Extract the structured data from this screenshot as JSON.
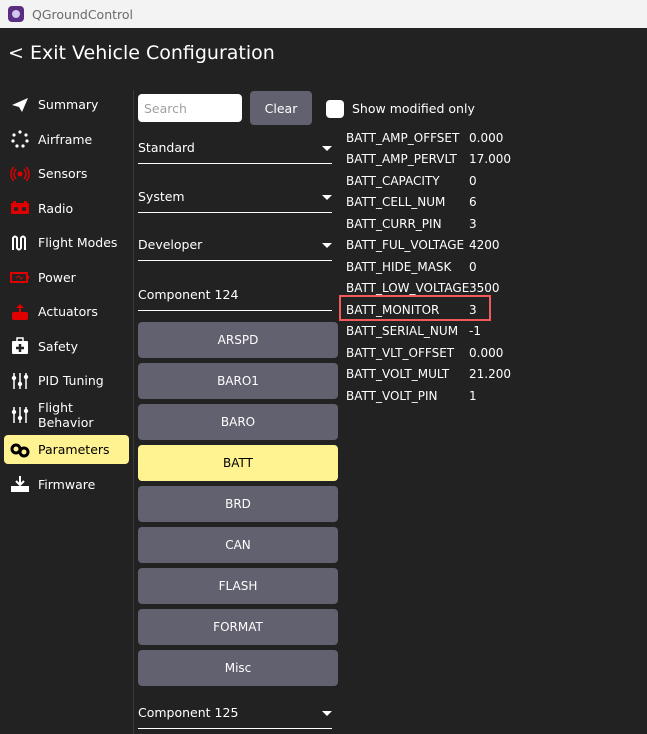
{
  "window": {
    "title": "QGroundControl"
  },
  "header": {
    "title": "< Exit Vehicle Configuration"
  },
  "sidebar": {
    "items": [
      {
        "label": "Summary",
        "icon": "paper-plane-icon"
      },
      {
        "label": "Airframe",
        "icon": "airframe-dots-icon"
      },
      {
        "label": "Sensors",
        "icon": "sensors-icon"
      },
      {
        "label": "Radio",
        "icon": "radio-icon"
      },
      {
        "label": "Flight Modes",
        "icon": "flight-modes-icon"
      },
      {
        "label": "Power",
        "icon": "battery-icon"
      },
      {
        "label": "Actuators",
        "icon": "actuators-icon"
      },
      {
        "label": "Safety",
        "icon": "first-aid-icon"
      },
      {
        "label": "PID Tuning",
        "icon": "sliders-icon"
      },
      {
        "label": "Flight Behavior",
        "icon": "sliders-icon"
      },
      {
        "label": "Parameters",
        "icon": "gears-icon",
        "active": true
      },
      {
        "label": "Firmware",
        "icon": "firmware-download-icon"
      }
    ]
  },
  "toolbar": {
    "search_placeholder": "Search",
    "clear_label": "Clear",
    "show_modified_label": "Show modified only"
  },
  "filters": {
    "level": "Standard",
    "category": "System",
    "mode": "Developer",
    "component": "Component 124",
    "component2": "Component 125"
  },
  "groups": [
    "ARSPD",
    "BARO1",
    "BARO",
    "BATT",
    "BRD",
    "CAN",
    "FLASH",
    "FORMAT",
    "Misc"
  ],
  "selected_group": "BATT",
  "params": [
    {
      "name": "BATT_AMP_OFFSET",
      "value": "0.000"
    },
    {
      "name": "BATT_AMP_PERVLT",
      "value": "17.000"
    },
    {
      "name": "BATT_CAPACITY",
      "value": "0"
    },
    {
      "name": "BATT_CELL_NUM",
      "value": "6"
    },
    {
      "name": "BATT_CURR_PIN",
      "value": "3"
    },
    {
      "name": "BATT_FUL_VOLTAGE",
      "value": "4200"
    },
    {
      "name": "BATT_HIDE_MASK",
      "value": "0"
    },
    {
      "name": "BATT_LOW_VOLTAGE",
      "value": "3500"
    },
    {
      "name": "BATT_MONITOR",
      "value": "3"
    },
    {
      "name": "BATT_SERIAL_NUM",
      "value": "-1"
    },
    {
      "name": "BATT_VLT_OFFSET",
      "value": "0.000"
    },
    {
      "name": "BATT_VOLT_MULT",
      "value": "21.200"
    },
    {
      "name": "BATT_VOLT_PIN",
      "value": "1"
    }
  ],
  "highlighted_param": "BATT_MONITOR",
  "colors": {
    "accent": "#fff291",
    "button": "#62616f",
    "highlight": "#f05a5a",
    "vehicle_red": "#e00000"
  }
}
